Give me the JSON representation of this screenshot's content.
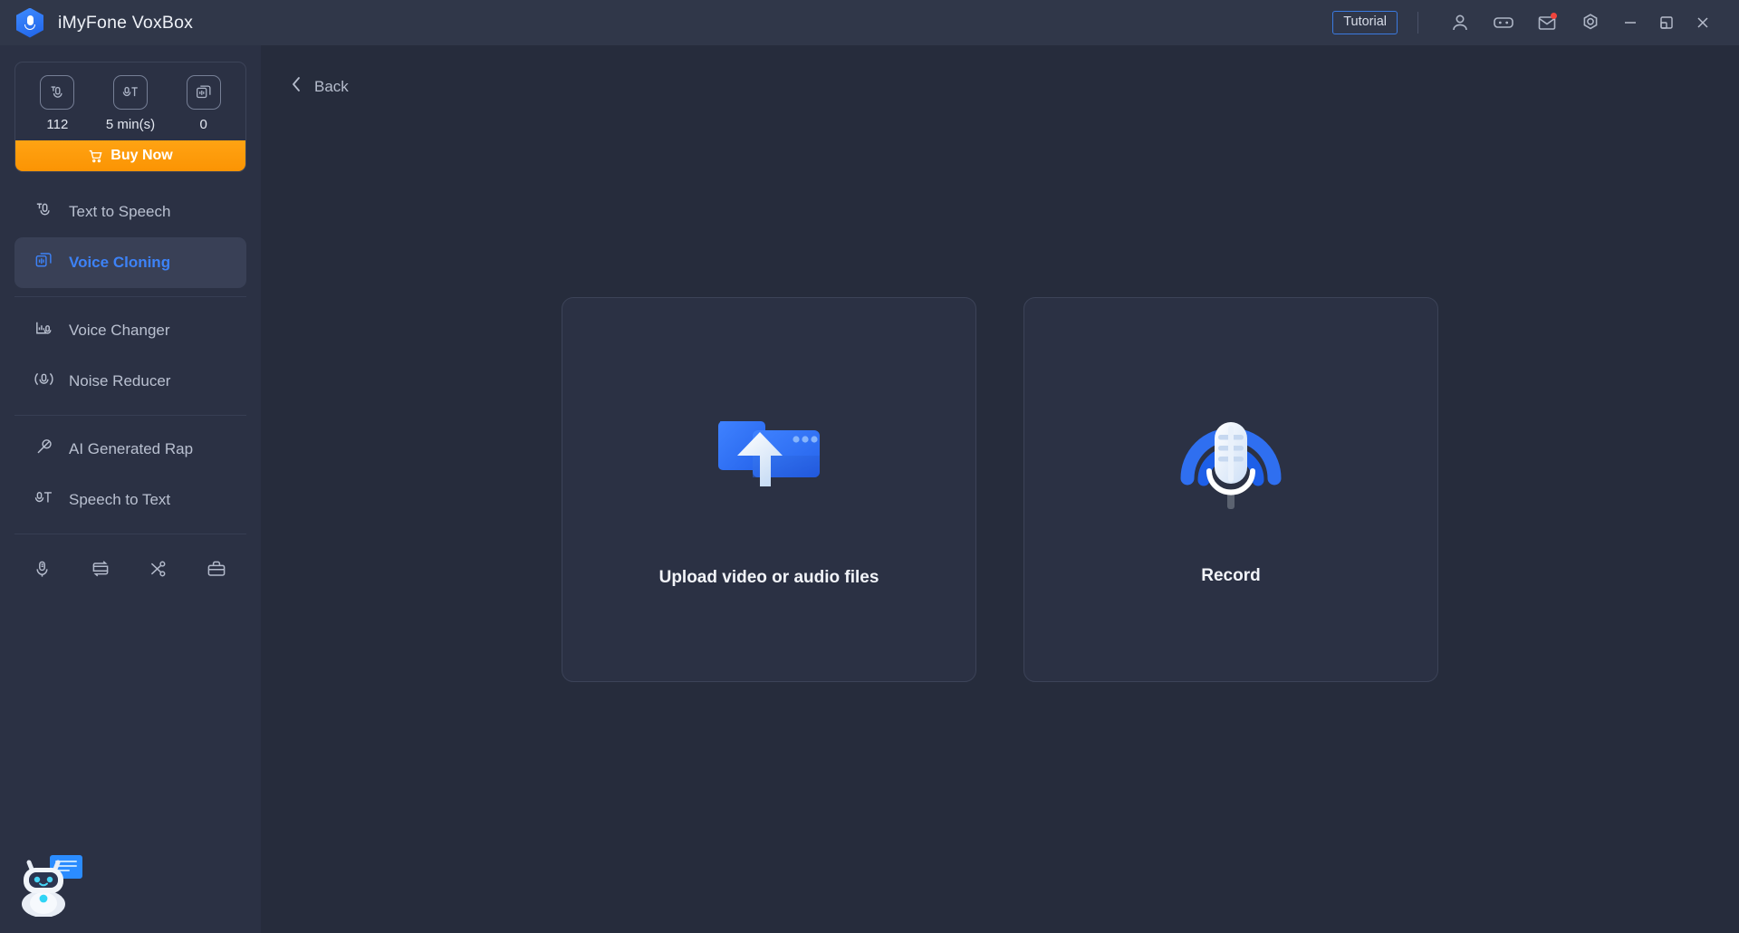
{
  "app": {
    "title": "iMyFone VoxBox",
    "logo_icon": "voxbox-mic-logo"
  },
  "titlebar": {
    "tutorial_label": "Tutorial",
    "icons": [
      {
        "name": "account-icon",
        "label": "Account"
      },
      {
        "name": "discord-icon",
        "label": "Discord"
      },
      {
        "name": "mail-icon",
        "label": "Messages",
        "badge": true
      },
      {
        "name": "settings-icon",
        "label": "Settings"
      }
    ],
    "window_controls": [
      {
        "name": "minimize-button",
        "glyph": "minimize"
      },
      {
        "name": "maximize-button",
        "glyph": "maximize"
      },
      {
        "name": "close-button",
        "glyph": "close"
      }
    ]
  },
  "sidebar": {
    "credits": [
      {
        "icon": "text-to-speech-credit-icon",
        "value": "112"
      },
      {
        "icon": "speech-to-text-credit-icon",
        "value": "5 min(s)"
      },
      {
        "icon": "voice-cloning-credit-icon",
        "value": "0"
      }
    ],
    "buy_now_label": "Buy Now",
    "buy_now_icon": "cart-icon",
    "buy_now_color": "#fb9403",
    "accent_color": "#3d82f7",
    "items": [
      {
        "label": "Text to Speech",
        "icon": "text-to-speech-icon",
        "active": false
      },
      {
        "label": "Voice Cloning",
        "icon": "voice-cloning-icon",
        "active": true
      },
      {
        "label": "Voice Changer",
        "icon": "voice-changer-icon",
        "active": false
      },
      {
        "label": "Noise Reducer",
        "icon": "noise-reducer-icon",
        "active": false
      },
      {
        "label": "AI Generated Rap",
        "icon": "ai-generated-rap-icon",
        "active": false
      },
      {
        "label": "Speech to Text",
        "icon": "speech-to-text-icon",
        "active": false
      }
    ],
    "tools": [
      {
        "icon": "voice-recorder-icon"
      },
      {
        "icon": "audio-converter-icon"
      },
      {
        "icon": "audio-cutter-icon"
      },
      {
        "icon": "toolbox-icon"
      }
    ],
    "chatbot_icon": "chatbot-icon"
  },
  "main": {
    "back_label": "Back",
    "back_icon": "chevron-left-icon",
    "cards": [
      {
        "label": "Upload video or audio files",
        "icon": "upload-folder-icon"
      },
      {
        "label": "Record",
        "icon": "microphone-record-icon"
      }
    ]
  }
}
